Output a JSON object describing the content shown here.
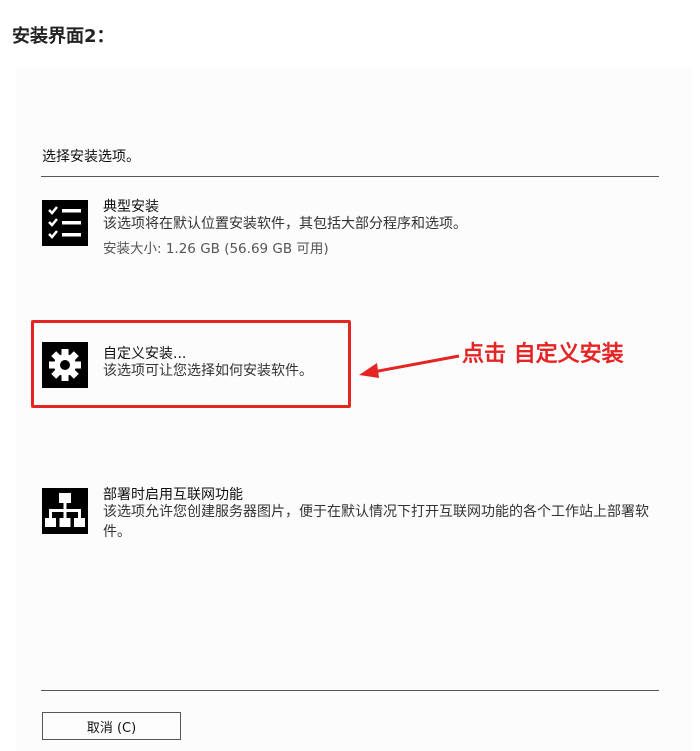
{
  "heading": "安装界面2：",
  "prompt": "选择安装选项。",
  "options": [
    {
      "icon": "checklist-icon",
      "title": "典型安装",
      "description": "该选项将在默认位置安装软件，其包括大部分程序和选项。",
      "size": "安装大小: 1.26 GB (56.69 GB 可用)"
    },
    {
      "icon": "gear-icon",
      "title": "自定义安装...",
      "description": "该选项可让您选择如何安装软件。"
    },
    {
      "icon": "network-icon",
      "title": "部署时启用互联网功能",
      "description": "该选项允许您创建服务器图片，便于在默认情况下打开互联网功能的各个工作站上部署软件。"
    }
  ],
  "annotation": "点击 自定义安装",
  "colors": {
    "annotation": "#e52424"
  },
  "cancel_button": "取消 (C)"
}
